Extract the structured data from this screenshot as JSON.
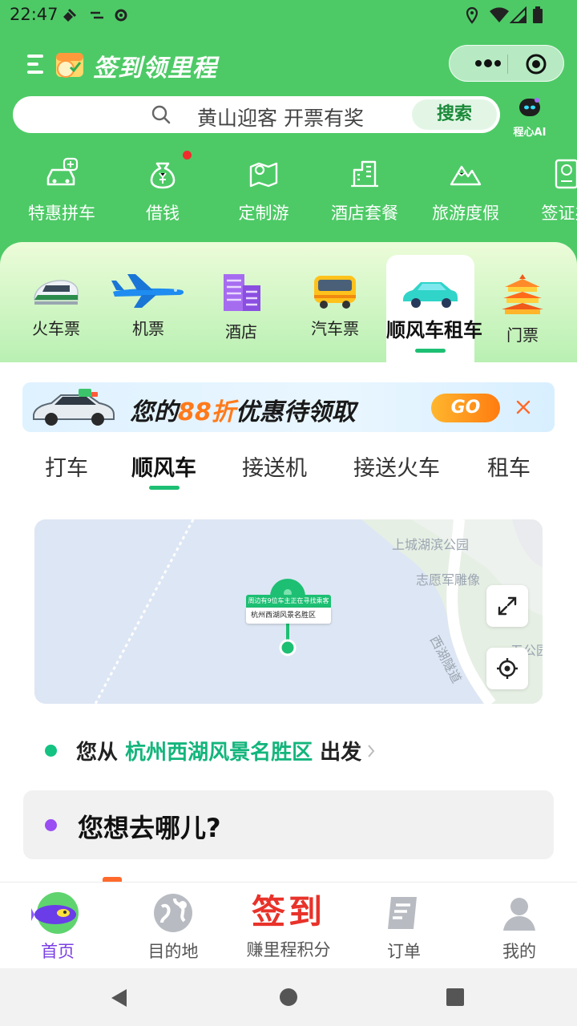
{
  "status_bar": {
    "time": "22:47"
  },
  "header": {
    "title": "签到领里程"
  },
  "search": {
    "placeholder": "黄山迎客 开票有奖",
    "button": "搜索"
  },
  "ai": {
    "label": "程心AI"
  },
  "quick_menu": [
    {
      "label": "特惠拼车",
      "icon": "carpool-icon"
    },
    {
      "label": "借钱",
      "icon": "money-bag-icon"
    },
    {
      "label": "定制游",
      "icon": "map-pin-icon"
    },
    {
      "label": "酒店套餐",
      "icon": "building-icon"
    },
    {
      "label": "旅游度假",
      "icon": "mountain-icon"
    },
    {
      "label": "签证办",
      "icon": "passport-icon"
    }
  ],
  "categories": [
    {
      "label": "火车票"
    },
    {
      "label": "机票"
    },
    {
      "label": "酒店"
    },
    {
      "label": "汽车票"
    },
    {
      "label": "顺风车租车"
    },
    {
      "label": "门票"
    }
  ],
  "banner": {
    "text_prefix": "您的",
    "highlight": "88折",
    "text_suffix": "优惠待领取",
    "go": "GO"
  },
  "service_tabs": [
    {
      "label": "打车"
    },
    {
      "label": "顺风车"
    },
    {
      "label": "接送机"
    },
    {
      "label": "接送火车"
    },
    {
      "label": "租车"
    }
  ],
  "map": {
    "labels": [
      "上城湖滨公园",
      "志愿军雕像",
      "西湖隧道",
      "五公园"
    ],
    "callout_note": "周边有9位车主正在寻找乘客",
    "callout_place": "杭州西湖风景名胜区"
  },
  "trip": {
    "from_prefix": "您从",
    "from_location": "杭州西湖风景名胜区",
    "from_suffix": "出发",
    "to_placeholder": "您想去哪儿?"
  },
  "bottom_nav": [
    {
      "label": "首页"
    },
    {
      "label": "目的地"
    },
    {
      "big": "签到",
      "label": "赚里程积分"
    },
    {
      "label": "订单"
    },
    {
      "label": "我的"
    }
  ],
  "colors": {
    "brand_green": "#4dca66",
    "accent_teal": "#1dbf73",
    "purple": "#7a3fe4"
  }
}
